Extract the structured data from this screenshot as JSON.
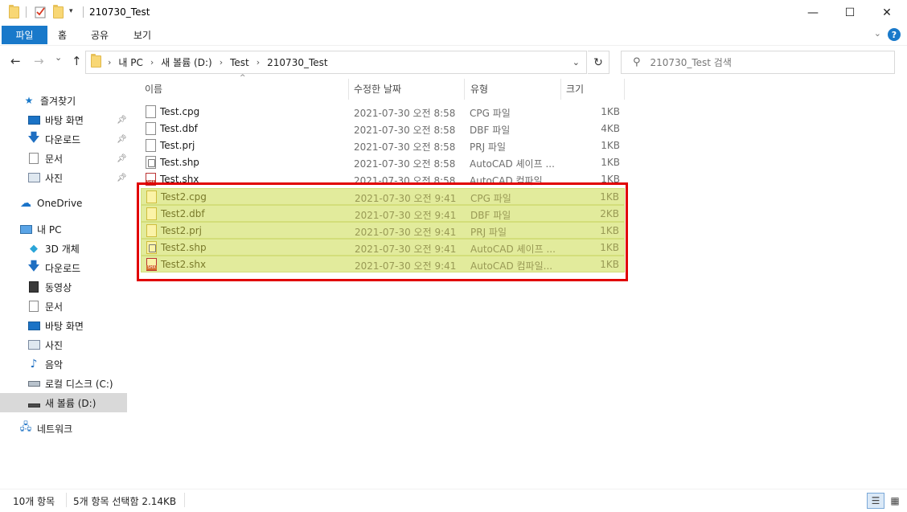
{
  "window": {
    "title": "210730_Test",
    "controls": {
      "minimize": "—",
      "maximize": "☐",
      "close": "✕"
    }
  },
  "ribbon": {
    "tabs": [
      "파일",
      "홈",
      "공유",
      "보기"
    ],
    "help": "?"
  },
  "address": {
    "back": "←",
    "forward": "→",
    "recent": "⌄",
    "up": "↑",
    "breadcrumb": [
      "내 PC",
      "새 볼륨 (D:)",
      "Test",
      "210730_Test"
    ],
    "refresh": "↻",
    "search_placeholder": "210730_Test 검색"
  },
  "nav": {
    "quick_access": "즐겨찾기",
    "quick_items": [
      "바탕 화면",
      "다운로드",
      "문서",
      "사진"
    ],
    "onedrive": "OneDrive",
    "this_pc": "내 PC",
    "pc_items": [
      "3D 개체",
      "다운로드",
      "동영상",
      "문서",
      "바탕 화면",
      "사진",
      "음악",
      "로컬 디스크 (C:)",
      "새 볼륨 (D:)"
    ],
    "network": "네트워크"
  },
  "columns": {
    "name": "이름",
    "date": "수정한 날짜",
    "type": "유형",
    "size": "크기"
  },
  "files": [
    {
      "name": "Test.cpg",
      "date": "2021-07-30 오전 8:58",
      "type": "CPG 파일",
      "size": "1KB",
      "icon": "doc"
    },
    {
      "name": "Test.dbf",
      "date": "2021-07-30 오전 8:58",
      "type": "DBF 파일",
      "size": "4KB",
      "icon": "doc"
    },
    {
      "name": "Test.prj",
      "date": "2021-07-30 오전 8:58",
      "type": "PRJ 파일",
      "size": "1KB",
      "icon": "doc"
    },
    {
      "name": "Test.shp",
      "date": "2021-07-30 오전 8:58",
      "type": "AutoCAD 셰이프 ...",
      "size": "1KB",
      "icon": "shp"
    },
    {
      "name": "Test.shx",
      "date": "2021-07-30 오전 8:58",
      "type": "AutoCAD 컴파일...",
      "size": "1KB",
      "icon": "shx"
    },
    {
      "name": "Test2.cpg",
      "date": "2021-07-30 오전 9:41",
      "type": "CPG 파일",
      "size": "1KB",
      "icon": "doc"
    },
    {
      "name": "Test2.dbf",
      "date": "2021-07-30 오전 9:41",
      "type": "DBF 파일",
      "size": "2KB",
      "icon": "doc"
    },
    {
      "name": "Test2.prj",
      "date": "2021-07-30 오전 9:41",
      "type": "PRJ 파일",
      "size": "1KB",
      "icon": "doc"
    },
    {
      "name": "Test2.shp",
      "date": "2021-07-30 오전 9:41",
      "type": "AutoCAD 셰이프 ...",
      "size": "1KB",
      "icon": "shp"
    },
    {
      "name": "Test2.shx",
      "date": "2021-07-30 오전 9:41",
      "type": "AutoCAD 컴파일...",
      "size": "1KB",
      "icon": "shx"
    }
  ],
  "status": {
    "count": "10개 항목",
    "selection": "5개 항목 선택함 2.14KB"
  },
  "colors": {
    "accent": "#1979ca",
    "selection": "#e2eb9c",
    "highlight_border": "#e10000"
  }
}
